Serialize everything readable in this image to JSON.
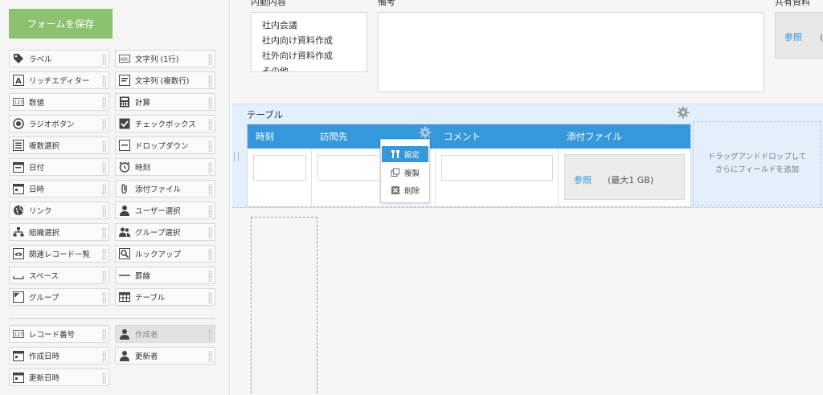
{
  "sidebar": {
    "save_label": "フォームを保存",
    "items": [
      {
        "label": "ラベル",
        "icon": "tag-icon"
      },
      {
        "label": "文字列 (1行)",
        "icon": "text-abc-icon"
      },
      {
        "label": "リッチエディター",
        "icon": "rich-editor-icon"
      },
      {
        "label": "文字列 (複数行)",
        "icon": "multiline-text-icon"
      },
      {
        "label": "数値",
        "icon": "number-123-icon"
      },
      {
        "label": "計算",
        "icon": "calculator-icon"
      },
      {
        "label": "ラジオボタン",
        "icon": "radio-icon"
      },
      {
        "label": "チェックボックス",
        "icon": "checkbox-icon"
      },
      {
        "label": "複数選択",
        "icon": "multi-select-icon"
      },
      {
        "label": "ドロップダウン",
        "icon": "dropdown-icon"
      },
      {
        "label": "日付",
        "icon": "date-icon"
      },
      {
        "label": "時刻",
        "icon": "clock-icon"
      },
      {
        "label": "日時",
        "icon": "datetime-icon"
      },
      {
        "label": "添付ファイル",
        "icon": "paperclip-icon"
      },
      {
        "label": "リンク",
        "icon": "globe-icon"
      },
      {
        "label": "ユーザー選択",
        "icon": "user-icon"
      },
      {
        "label": "組織選択",
        "icon": "org-icon"
      },
      {
        "label": "グループ選択",
        "icon": "group-icon"
      },
      {
        "label": "関連レコード一覧",
        "icon": "eye-icon"
      },
      {
        "label": "ルックアップ",
        "icon": "lookup-icon"
      },
      {
        "label": "スペース",
        "icon": "space-icon"
      },
      {
        "label": "罫線",
        "icon": "line-icon"
      },
      {
        "label": "グループ",
        "icon": "group-field-icon"
      },
      {
        "label": "テーブル",
        "icon": "table-icon"
      }
    ],
    "system_items": [
      {
        "label": "レコード番号",
        "icon": "number-123-icon"
      },
      {
        "label": "作成者",
        "icon": "user-icon",
        "disabled": true
      },
      {
        "label": "作成日時",
        "icon": "datetime-icon"
      },
      {
        "label": "更新者",
        "icon": "user-icon"
      },
      {
        "label": "更新日時",
        "icon": "datetime-icon"
      }
    ]
  },
  "canvas": {
    "naiyo_label": "内勤内容",
    "naiyo_options": [
      "社内会議",
      "社内向け資料作成",
      "社外向け資料作成",
      "その他"
    ],
    "biko_label": "備考",
    "kyoyu_label": "共有資料",
    "kyoyu_browse": "参照",
    "kyoyu_limit": "(最",
    "table": {
      "title": "テーブル",
      "columns": [
        "時刻",
        "訪問先",
        "コメント",
        "添付ファイル"
      ],
      "attach_browse": "参照",
      "attach_limit": "(最大1 GB)",
      "dropzone_line1": "ドラッグアンドドロップして",
      "dropzone_line2": "さらにフィールドを追加"
    },
    "context_menu": {
      "settings": "設定",
      "duplicate": "複製",
      "delete": "削除"
    }
  },
  "colors": {
    "save_button": "#8cc26f",
    "table_header": "#3498db",
    "table_area": "#e3f0fb",
    "link": "#3498db"
  }
}
